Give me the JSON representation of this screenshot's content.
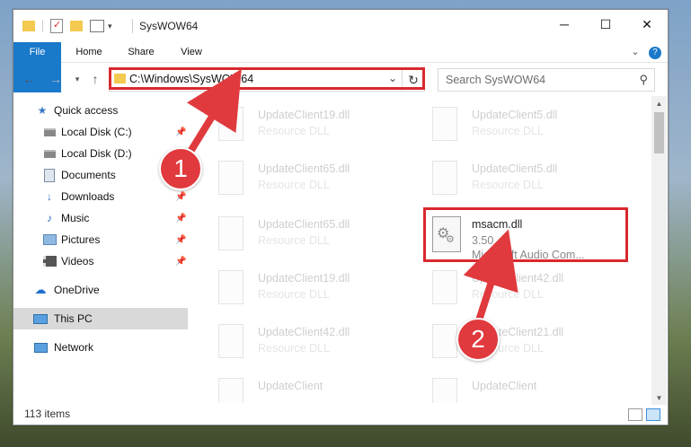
{
  "window": {
    "title": "SysWOW64",
    "controls": {
      "minimize": "─",
      "maximize": "☐",
      "close": "✕"
    }
  },
  "ribbon": {
    "tabs": [
      "File",
      "Home",
      "Share",
      "View"
    ],
    "expand_icon": "chevron-down-icon",
    "help_icon": "help-icon"
  },
  "navigation": {
    "back_icon": "back-arrow-icon",
    "forward_icon": "forward-arrow-icon",
    "recent_icon": "chevron-down-icon",
    "up_icon": "up-arrow-icon",
    "address_path": "C:\\Windows\\SysWOW64",
    "search_placeholder": "Search SysWOW64"
  },
  "sidebar": {
    "items": [
      {
        "label": "Quick access",
        "icon": "star-icon",
        "pinned": false
      },
      {
        "label": "Local Disk (C:)",
        "icon": "drive-icon",
        "pinned": true
      },
      {
        "label": "Local Disk (D:)",
        "icon": "drive-icon",
        "pinned": false
      },
      {
        "label": "Documents",
        "icon": "documents-icon",
        "pinned": true
      },
      {
        "label": "Downloads",
        "icon": "download-icon",
        "pinned": true
      },
      {
        "label": "Music",
        "icon": "music-icon",
        "pinned": true
      },
      {
        "label": "Pictures",
        "icon": "pictures-icon",
        "pinned": true
      },
      {
        "label": "Videos",
        "icon": "videos-icon",
        "pinned": true
      },
      {
        "label": "OneDrive",
        "icon": "cloud-icon",
        "pinned": false
      },
      {
        "label": "This PC",
        "icon": "computer-icon",
        "pinned": false,
        "selected": true
      },
      {
        "label": "Network",
        "icon": "network-icon",
        "pinned": false
      }
    ]
  },
  "files": [
    {
      "name": "UpdateClient19.dll",
      "type": "Resource DLL",
      "faded": true
    },
    {
      "name": "UpdateClient5.dll",
      "type": "Resource DLL",
      "faded": true
    },
    {
      "name": "UpdateClient65.dll",
      "type": "Resource DLL",
      "faded": true
    },
    {
      "name": "UpdateClient5.dll",
      "type": "Resource DLL",
      "faded": true
    },
    {
      "name": "UpdateClient65.dll",
      "type": "Resource DLL",
      "faded": true
    },
    {
      "name": "msacm.dll",
      "version": "3.50",
      "type": "Microsoft Audio Com...",
      "faded": false
    },
    {
      "name": "UpdateClient19.dll",
      "type": "Resource DLL",
      "faded": true
    },
    {
      "name": "UpdateClient42.dll",
      "type": "Resource DLL",
      "faded": true
    },
    {
      "name": "UpdateClient42.dll",
      "type": "Resource DLL",
      "faded": true
    },
    {
      "name": "UpdateClient21.dll",
      "type": "Resource DLL",
      "faded": true
    },
    {
      "name": "UpdateClient",
      "type": "",
      "faded": true
    },
    {
      "name": "UpdateClient",
      "type": "",
      "faded": true
    }
  ],
  "status": {
    "item_count": "113 items"
  },
  "callouts": {
    "one": "1",
    "two": "2"
  },
  "colors": {
    "accent": "#1979ca",
    "highlight": "#d9292f",
    "folder": "#f3c94f"
  }
}
